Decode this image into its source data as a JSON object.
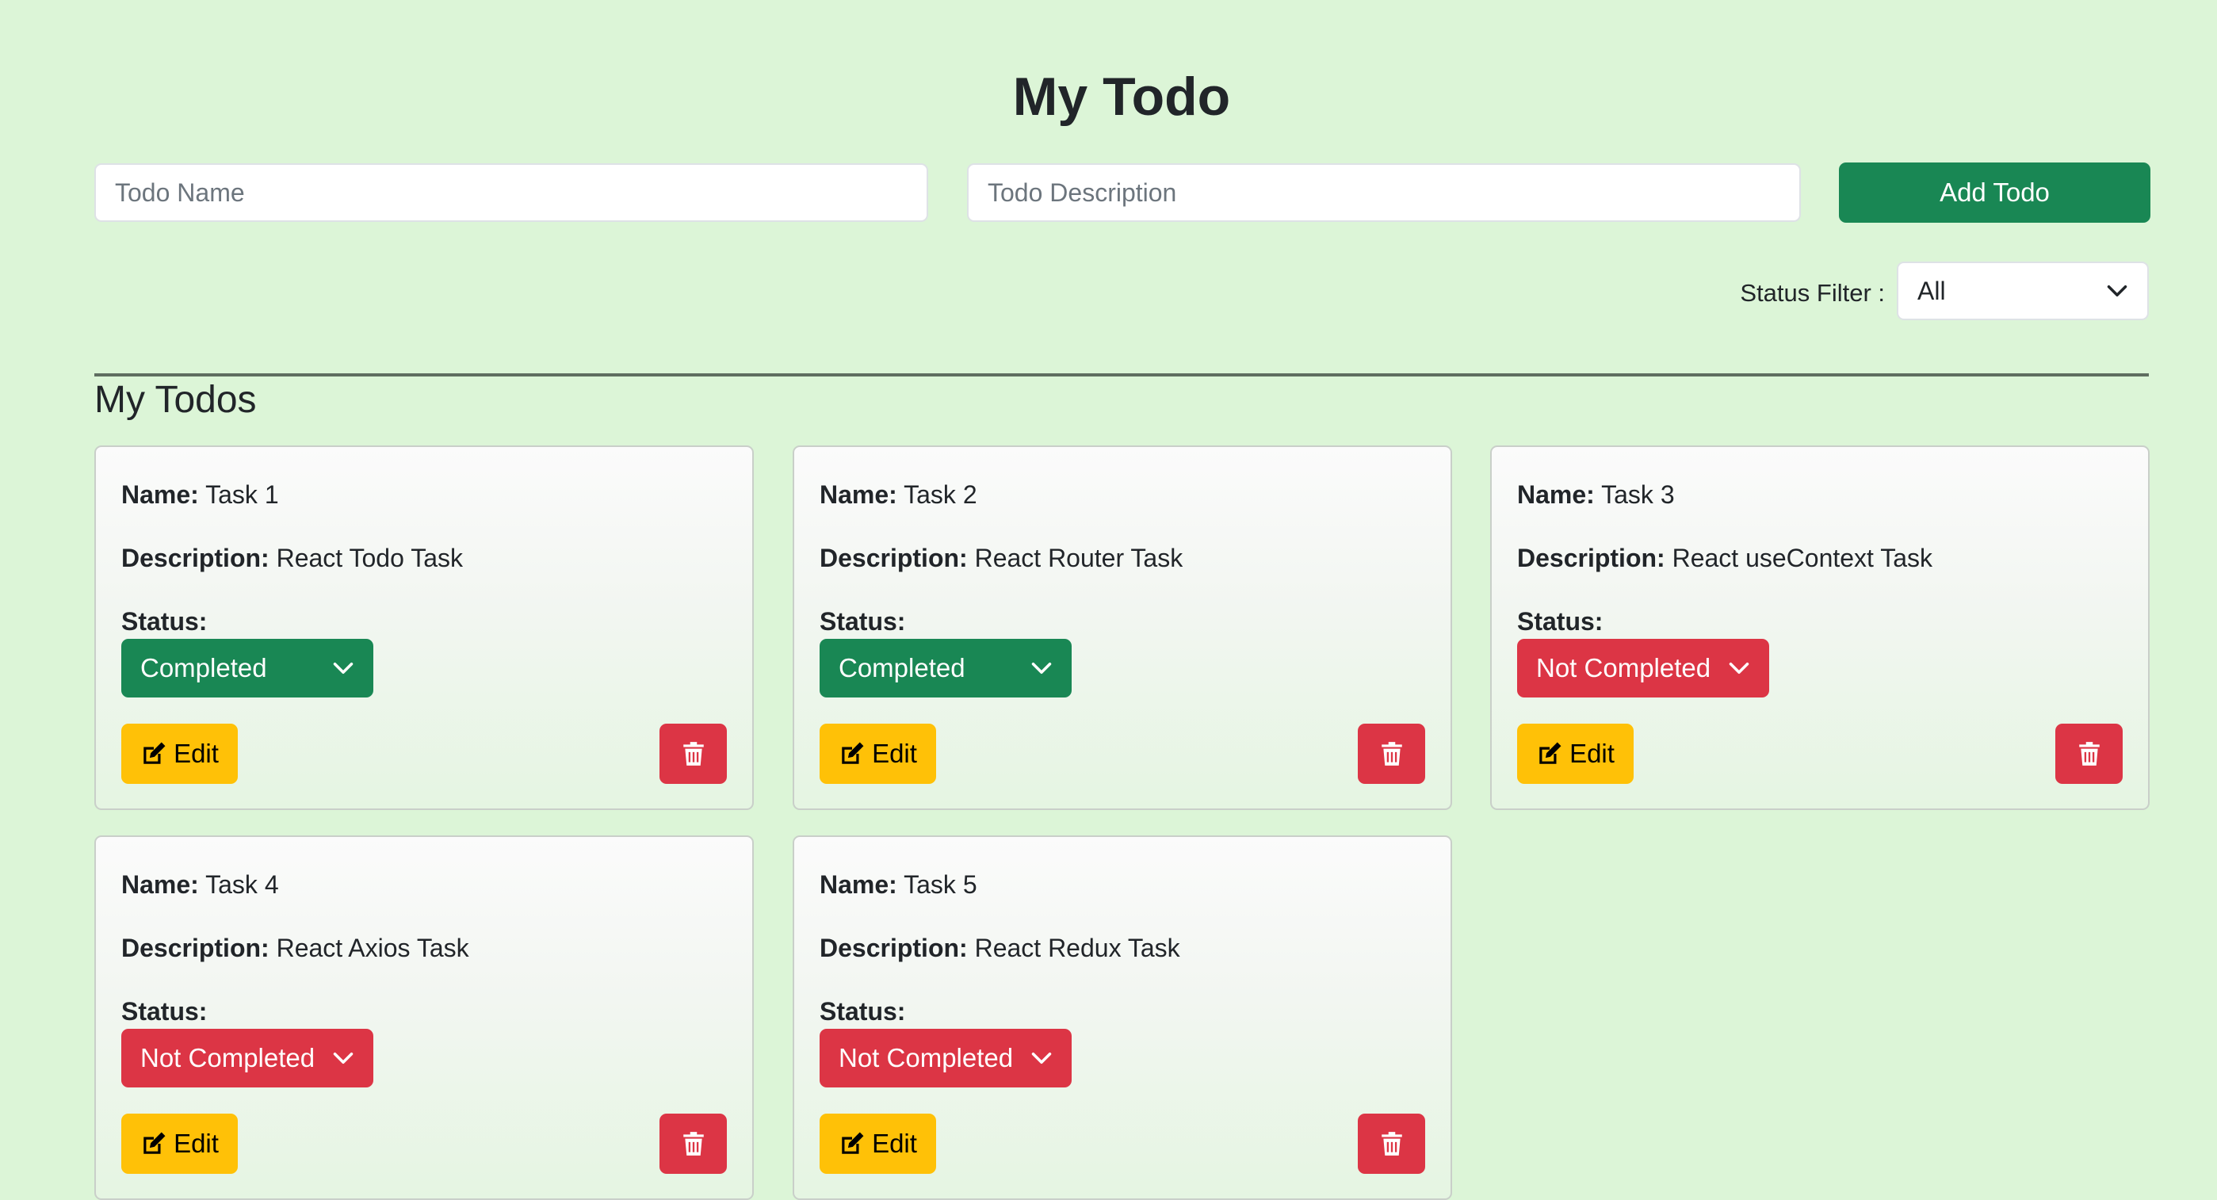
{
  "header": {
    "title": "My Todo"
  },
  "form": {
    "name_placeholder": "Todo Name",
    "description_placeholder": "Todo Description",
    "add_button_label": "Add Todo"
  },
  "filter": {
    "label": "Status Filter :",
    "selected": "All"
  },
  "section": {
    "title": "My Todos"
  },
  "labels": {
    "name": "Name:",
    "description": "Description:",
    "status": "Status:",
    "edit": "Edit"
  },
  "todos": [
    {
      "name": "Task 1",
      "description": "React Todo Task",
      "status": "Completed"
    },
    {
      "name": "Task 2",
      "description": "React Router Task",
      "status": "Completed"
    },
    {
      "name": "Task 3",
      "description": "React useContext Task",
      "status": "Not Completed"
    },
    {
      "name": "Task 4",
      "description": "React Axios Task",
      "status": "Not Completed"
    },
    {
      "name": "Task 5",
      "description": "React Redux Task",
      "status": "Not Completed"
    }
  ],
  "colors": {
    "background": "#dcf5d7",
    "completed": "#198754",
    "not_completed": "#dc3545",
    "edit": "#ffc107",
    "delete": "#dc3545",
    "primary_action": "#198754"
  },
  "icons": {
    "edit": "edit-icon",
    "delete": "trash-icon",
    "dropdown": "chevron-down-icon"
  }
}
